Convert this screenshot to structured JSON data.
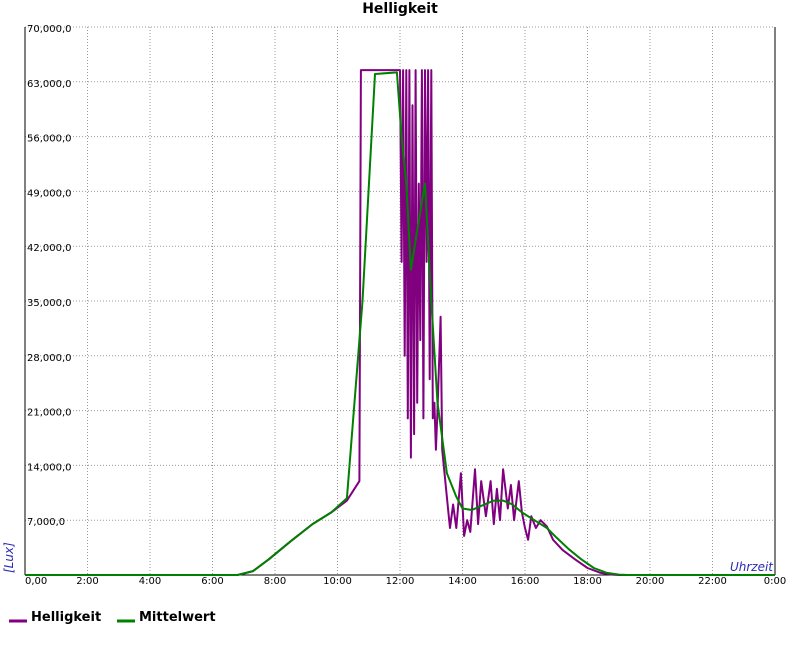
{
  "chart_data": {
    "type": "line",
    "title": "Helligkeit",
    "xlabel": "Uhrzeit",
    "ylabel": "[Lux]",
    "xlim": [
      0,
      24
    ],
    "ylim": [
      0,
      70000
    ],
    "grid": true,
    "legend_position": "bottom-left",
    "x_ticks": [
      "0,00",
      "2:00",
      "4:00",
      "6:00",
      "8:00",
      "10:00",
      "12:00",
      "14:00",
      "16:00",
      "18:00",
      "20:00",
      "22:00",
      "0:00"
    ],
    "y_ticks": [
      "7,000,0",
      "14,000,0",
      "21,000,0",
      "28,000,0",
      "35,000,0",
      "42,000,0",
      "49,000,0",
      "56,000,0",
      "63,000,0",
      "70,000,0"
    ],
    "y_tick_values": [
      7000,
      14000,
      21000,
      28000,
      35000,
      42000,
      49000,
      56000,
      63000,
      70000
    ],
    "series": [
      {
        "name": "Helligkeit",
        "color": "#800080",
        "points": [
          [
            0,
            0
          ],
          [
            6.8,
            0
          ],
          [
            7.3,
            500
          ],
          [
            7.8,
            2000
          ],
          [
            8.5,
            4300
          ],
          [
            9.2,
            6500
          ],
          [
            9.8,
            8000
          ],
          [
            10.3,
            9500
          ],
          [
            10.7,
            12000
          ],
          [
            10.75,
            64500
          ],
          [
            11.9,
            64500
          ],
          [
            12.0,
            64500
          ],
          [
            12.05,
            40000
          ],
          [
            12.1,
            64500
          ],
          [
            12.15,
            28000
          ],
          [
            12.2,
            64500
          ],
          [
            12.25,
            20000
          ],
          [
            12.3,
            64500
          ],
          [
            12.35,
            15000
          ],
          [
            12.4,
            60000
          ],
          [
            12.45,
            18000
          ],
          [
            12.5,
            64500
          ],
          [
            12.55,
            22000
          ],
          [
            12.6,
            50000
          ],
          [
            12.65,
            30000
          ],
          [
            12.7,
            64500
          ],
          [
            12.75,
            20000
          ],
          [
            12.8,
            64500
          ],
          [
            12.85,
            40000
          ],
          [
            12.9,
            64500
          ],
          [
            12.95,
            25000
          ],
          [
            13.0,
            64500
          ],
          [
            13.05,
            20000
          ],
          [
            13.1,
            22000
          ],
          [
            13.15,
            16000
          ],
          [
            13.2,
            21000
          ],
          [
            13.3,
            33000
          ],
          [
            13.35,
            16000
          ],
          [
            13.45,
            12000
          ],
          [
            13.55,
            8000
          ],
          [
            13.6,
            6000
          ],
          [
            13.7,
            9000
          ],
          [
            13.8,
            6000
          ],
          [
            13.95,
            13000
          ],
          [
            14.05,
            5000
          ],
          [
            14.15,
            7000
          ],
          [
            14.25,
            5500
          ],
          [
            14.4,
            13500
          ],
          [
            14.5,
            6500
          ],
          [
            14.6,
            12000
          ],
          [
            14.75,
            7500
          ],
          [
            14.9,
            12000
          ],
          [
            15.0,
            6500
          ],
          [
            15.1,
            11000
          ],
          [
            15.2,
            7000
          ],
          [
            15.3,
            13500
          ],
          [
            15.45,
            8500
          ],
          [
            15.55,
            11500
          ],
          [
            15.65,
            7000
          ],
          [
            15.8,
            12000
          ],
          [
            15.9,
            8000
          ],
          [
            16.0,
            6000
          ],
          [
            16.1,
            4500
          ],
          [
            16.2,
            7500
          ],
          [
            16.35,
            6000
          ],
          [
            16.5,
            7000
          ],
          [
            16.7,
            6200
          ],
          [
            16.9,
            4500
          ],
          [
            17.2,
            3200
          ],
          [
            17.6,
            2000
          ],
          [
            18.0,
            900
          ],
          [
            18.4,
            300
          ],
          [
            18.8,
            50
          ],
          [
            19.0,
            0
          ],
          [
            24,
            0
          ]
        ]
      },
      {
        "name": "Mittelwert",
        "color": "#008000",
        "points": [
          [
            0,
            0
          ],
          [
            6.8,
            0
          ],
          [
            7.3,
            500
          ],
          [
            7.8,
            2000
          ],
          [
            8.5,
            4300
          ],
          [
            9.2,
            6500
          ],
          [
            9.8,
            8000
          ],
          [
            10.3,
            9800
          ],
          [
            10.8,
            35000
          ],
          [
            11.2,
            64000
          ],
          [
            11.9,
            64200
          ],
          [
            12.05,
            56000
          ],
          [
            12.2,
            50000
          ],
          [
            12.35,
            39000
          ],
          [
            12.55,
            44000
          ],
          [
            12.8,
            50000
          ],
          [
            13.0,
            35000
          ],
          [
            13.2,
            22000
          ],
          [
            13.5,
            13000
          ],
          [
            13.8,
            10000
          ],
          [
            14.0,
            8500
          ],
          [
            14.3,
            8300
          ],
          [
            14.7,
            9000
          ],
          [
            15.0,
            9500
          ],
          [
            15.3,
            9500
          ],
          [
            15.6,
            9000
          ],
          [
            15.9,
            8000
          ],
          [
            16.3,
            7000
          ],
          [
            16.7,
            6000
          ],
          [
            17.0,
            4800
          ],
          [
            17.4,
            3300
          ],
          [
            17.8,
            2000
          ],
          [
            18.2,
            900
          ],
          [
            18.6,
            300
          ],
          [
            19.0,
            50
          ],
          [
            19.3,
            0
          ],
          [
            24,
            0
          ]
        ]
      }
    ]
  },
  "legend": {
    "items": [
      {
        "label": "Helligkeit",
        "color": "#800080"
      },
      {
        "label": "Mittelwert",
        "color": "#008000"
      }
    ]
  }
}
